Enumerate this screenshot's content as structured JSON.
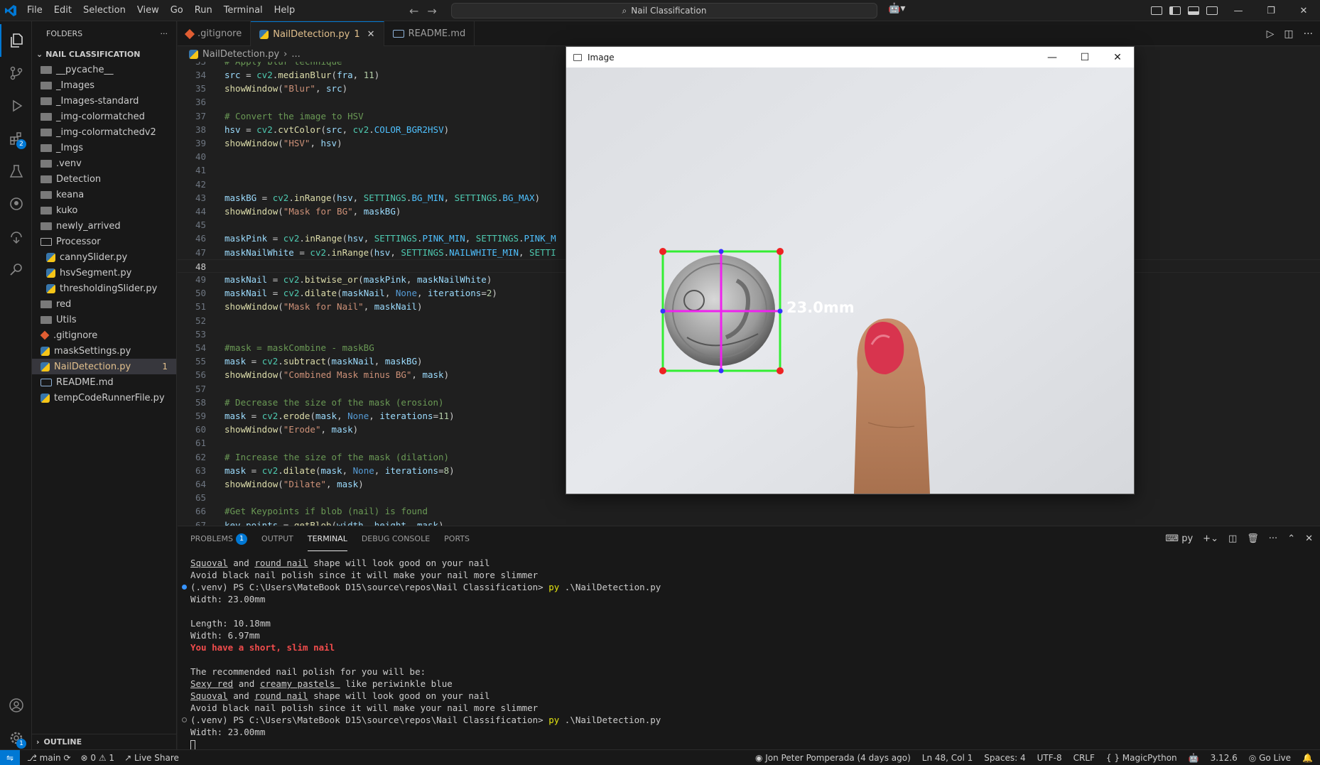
{
  "menu": [
    "File",
    "Edit",
    "Selection",
    "View",
    "Go",
    "Run",
    "Terminal",
    "Help"
  ],
  "search": {
    "text": "Nail Classification"
  },
  "sidebar": {
    "header": "FOLDERS",
    "section": "NAIL CLASSIFICATION",
    "items": [
      {
        "label": "__pycache__",
        "type": "folder",
        "indent": 0
      },
      {
        "label": "_Images",
        "type": "folder",
        "indent": 0
      },
      {
        "label": "_Images-standard",
        "type": "folder",
        "indent": 0
      },
      {
        "label": "_img-colormatched",
        "type": "folder",
        "indent": 0
      },
      {
        "label": "_img-colormatchedv2",
        "type": "folder",
        "indent": 0
      },
      {
        "label": "_Imgs",
        "type": "folder",
        "indent": 0
      },
      {
        "label": ".venv",
        "type": "folder",
        "indent": 0
      },
      {
        "label": "Detection",
        "type": "folder",
        "indent": 0
      },
      {
        "label": "keana",
        "type": "folder",
        "indent": 0
      },
      {
        "label": "kuko",
        "type": "folder",
        "indent": 0
      },
      {
        "label": "newly_arrived",
        "type": "folder",
        "indent": 0
      },
      {
        "label": "Processor",
        "type": "folder-open",
        "indent": 0
      },
      {
        "label": "cannySlider.py",
        "type": "py",
        "indent": 1
      },
      {
        "label": "hsvSegment.py",
        "type": "py",
        "indent": 1
      },
      {
        "label": "thresholdingSlider.py",
        "type": "py",
        "indent": 1
      },
      {
        "label": "red",
        "type": "folder",
        "indent": 0
      },
      {
        "label": "Utils",
        "type": "folder",
        "indent": 0
      },
      {
        "label": ".gitignore",
        "type": "git",
        "indent": 0
      },
      {
        "label": "maskSettings.py",
        "type": "py",
        "indent": 0
      },
      {
        "label": "NailDetection.py",
        "type": "py",
        "indent": 0,
        "selected": true,
        "count": "1"
      },
      {
        "label": "README.md",
        "type": "md",
        "indent": 0
      },
      {
        "label": "tempCodeRunnerFile.py",
        "type": "py",
        "indent": 0
      }
    ],
    "outline": "OUTLINE"
  },
  "activity_badges": {
    "extensions": "2",
    "settings": "1"
  },
  "tabs": [
    {
      "label": ".gitignore",
      "icon": "git",
      "active": false
    },
    {
      "label": "NailDetection.py",
      "count": "1",
      "icon": "py",
      "active": true
    },
    {
      "label": "README.md",
      "icon": "md",
      "active": false
    }
  ],
  "breadcrumb": {
    "file": "NailDetection.py",
    "rest": "..."
  },
  "code": {
    "current_line": 48,
    "lines": [
      {
        "n": 34,
        "html": "<span class='c-var'>src</span> = <span class='c-cls'>cv2</span>.<span class='c-fn'>medianBlur</span>(<span class='c-var'>fra</span>, <span class='c-num'>11</span>)"
      },
      {
        "n": 35,
        "html": "<span class='c-fn'>showWindow</span>(<span class='c-str'>\"Blur\"</span>, <span class='c-var'>src</span>)"
      },
      {
        "n": 36,
        "html": ""
      },
      {
        "n": 37,
        "html": "<span class='c-comment'># Convert the image to HSV</span>"
      },
      {
        "n": 38,
        "html": "<span class='c-var'>hsv</span> = <span class='c-cls'>cv2</span>.<span class='c-fn'>cvtColor</span>(<span class='c-var'>src</span>, <span class='c-cls'>cv2</span>.<span class='c-const'>COLOR_BGR2HSV</span>)"
      },
      {
        "n": 39,
        "html": "<span class='c-fn'>showWindow</span>(<span class='c-str'>\"HSV\"</span>, <span class='c-var'>hsv</span>)"
      },
      {
        "n": 40,
        "html": ""
      },
      {
        "n": 41,
        "html": ""
      },
      {
        "n": 42,
        "html": ""
      },
      {
        "n": 43,
        "html": "<span class='c-var'>maskBG</span> = <span class='c-cls'>cv2</span>.<span class='c-fn'>inRange</span>(<span class='c-var'>hsv</span>, <span class='c-cls'>SETTINGS</span>.<span class='c-const'>BG_MIN</span>, <span class='c-cls'>SETTINGS</span>.<span class='c-const'>BG_MAX</span>)"
      },
      {
        "n": 44,
        "html": "<span class='c-fn'>showWindow</span>(<span class='c-str'>\"Mask for BG\"</span>, <span class='c-var'>maskBG</span>)"
      },
      {
        "n": 45,
        "html": ""
      },
      {
        "n": 46,
        "html": "<span class='c-var'>maskPink</span> = <span class='c-cls'>cv2</span>.<span class='c-fn'>inRange</span>(<span class='c-var'>hsv</span>, <span class='c-cls'>SETTINGS</span>.<span class='c-const'>PINK_MIN</span>, <span class='c-cls'>SETTINGS</span>.<span class='c-const'>PINK_M</span>"
      },
      {
        "n": 47,
        "html": "<span class='c-var'>maskNailWhite</span> = <span class='c-cls'>cv2</span>.<span class='c-fn'>inRange</span>(<span class='c-var'>hsv</span>, <span class='c-cls'>SETTINGS</span>.<span class='c-const'>NAILWHITE_MIN</span>, <span class='c-cls'>SETTI</span>"
      },
      {
        "n": 48,
        "html": ""
      },
      {
        "n": 49,
        "html": "<span class='c-var'>maskNail</span> = <span class='c-cls'>cv2</span>.<span class='c-fn'>bitwise_or</span>(<span class='c-var'>maskPink</span>, <span class='c-var'>maskNailWhite</span>)"
      },
      {
        "n": 50,
        "html": "<span class='c-var'>maskNail</span> = <span class='c-cls'>cv2</span>.<span class='c-fn'>dilate</span>(<span class='c-var'>maskNail</span>, <span class='c-kw'>None</span>, <span class='c-var'>iterations</span>=<span class='c-num'>2</span>)"
      },
      {
        "n": 51,
        "html": "<span class='c-fn'>showWindow</span>(<span class='c-str'>\"Mask for Nail\"</span>, <span class='c-var'>maskNail</span>)"
      },
      {
        "n": 52,
        "html": ""
      },
      {
        "n": 53,
        "html": ""
      },
      {
        "n": 54,
        "html": "<span class='c-comment'>#mask = maskCombine - maskBG</span>"
      },
      {
        "n": 55,
        "html": "<span class='c-var'>mask</span> = <span class='c-cls'>cv2</span>.<span class='c-fn'>subtract</span>(<span class='c-var'>maskNail</span>, <span class='c-var'>maskBG</span>)"
      },
      {
        "n": 56,
        "html": "<span class='c-fn'>showWindow</span>(<span class='c-str'>\"Combined Mask minus BG\"</span>, <span class='c-var'>mask</span>)"
      },
      {
        "n": 57,
        "html": ""
      },
      {
        "n": 58,
        "html": "<span class='c-comment'># Decrease the size of the mask (erosion)</span>"
      },
      {
        "n": 59,
        "html": "<span class='c-var'>mask</span> = <span class='c-cls'>cv2</span>.<span class='c-fn'>erode</span>(<span class='c-var'>mask</span>, <span class='c-kw'>None</span>, <span class='c-var'>iterations</span>=<span class='c-num'>11</span>)"
      },
      {
        "n": 60,
        "html": "<span class='c-fn'>showWindow</span>(<span class='c-str'>\"Erode\"</span>, <span class='c-var'>mask</span>)"
      },
      {
        "n": 61,
        "html": ""
      },
      {
        "n": 62,
        "html": "<span class='c-comment'># Increase the size of the mask (dilation)</span>"
      },
      {
        "n": 63,
        "html": "<span class='c-var'>mask</span> = <span class='c-cls'>cv2</span>.<span class='c-fn'>dilate</span>(<span class='c-var'>mask</span>, <span class='c-kw'>None</span>, <span class='c-var'>iterations</span>=<span class='c-num'>8</span>)"
      },
      {
        "n": 64,
        "html": "<span class='c-fn'>showWindow</span>(<span class='c-str'>\"Dilate\"</span>, <span class='c-var'>mask</span>)"
      },
      {
        "n": 65,
        "html": ""
      },
      {
        "n": 66,
        "html": "<span class='c-comment'>#Get Keypoints if blob (nail) is found</span>"
      },
      {
        "n": 67,
        "html": "<span class='c-var'>key_points</span> = <span class='c-fn'>getBlob</span>(<span class='c-var'>width</span>, <span class='c-var'>height</span>, <span class='c-var'>mask</span>)"
      }
    ]
  },
  "panel": {
    "tabs": [
      {
        "label": "PROBLEMS",
        "badge": "1"
      },
      {
        "label": "OUTPUT"
      },
      {
        "label": "TERMINAL",
        "active": true
      },
      {
        "label": "DEBUG CONSOLE"
      },
      {
        "label": "PORTS"
      }
    ],
    "shell": "py",
    "terminal": [
      {
        "html": "<u>Squoval</u> and <u>round nail</u> shape will look good on your nail"
      },
      {
        "html": "Avoid black nail polish since it will make your nail more slimmer"
      },
      {
        "html": "(.venv) PS C:\\Users\\MateBook D15\\source\\repos\\Nail Classification> <span class='yellow'>py</span> .\\NailDetection.py",
        "dot": "blue"
      },
      {
        "html": "Width: 23.00mm"
      },
      {
        "html": ""
      },
      {
        "html": "Length: 10.18mm"
      },
      {
        "html": "Width: 6.97mm"
      },
      {
        "html": "You have a short, slim nail",
        "cls": "red"
      },
      {
        "html": ""
      },
      {
        "html": "The recommended nail polish for you will be:"
      },
      {
        "html": "<u>Sexy red</u> and <u>creamy pastels </u> like periwinkle blue"
      },
      {
        "html": "<u>Squoval</u> and <u>round nail</u> shape will look good on your nail"
      },
      {
        "html": "Avoid black nail polish since it will make your nail more slimmer"
      },
      {
        "html": "(.venv) PS C:\\Users\\MateBook D15\\source\\repos\\Nail Classification> <span class='yellow'>py</span> .\\NailDetection.py",
        "dot": "hollow"
      },
      {
        "html": "Width: 23.00mm"
      },
      {
        "html": "<span class='cursor-block'></span>"
      }
    ]
  },
  "statusbar": {
    "branch": "main",
    "errors": "0",
    "warnings": "1",
    "live_share": "Live Share",
    "blame": "Jon Peter Pomperada (4 days ago)",
    "position": "Ln 48, Col 1",
    "spaces": "Spaces: 4",
    "encoding": "UTF-8",
    "eol": "CRLF",
    "language": "MagicPython",
    "python_version": "3.12.6",
    "go_live": "Go Live"
  },
  "image_window": {
    "title": "Image",
    "measurement": "23.0mm"
  }
}
